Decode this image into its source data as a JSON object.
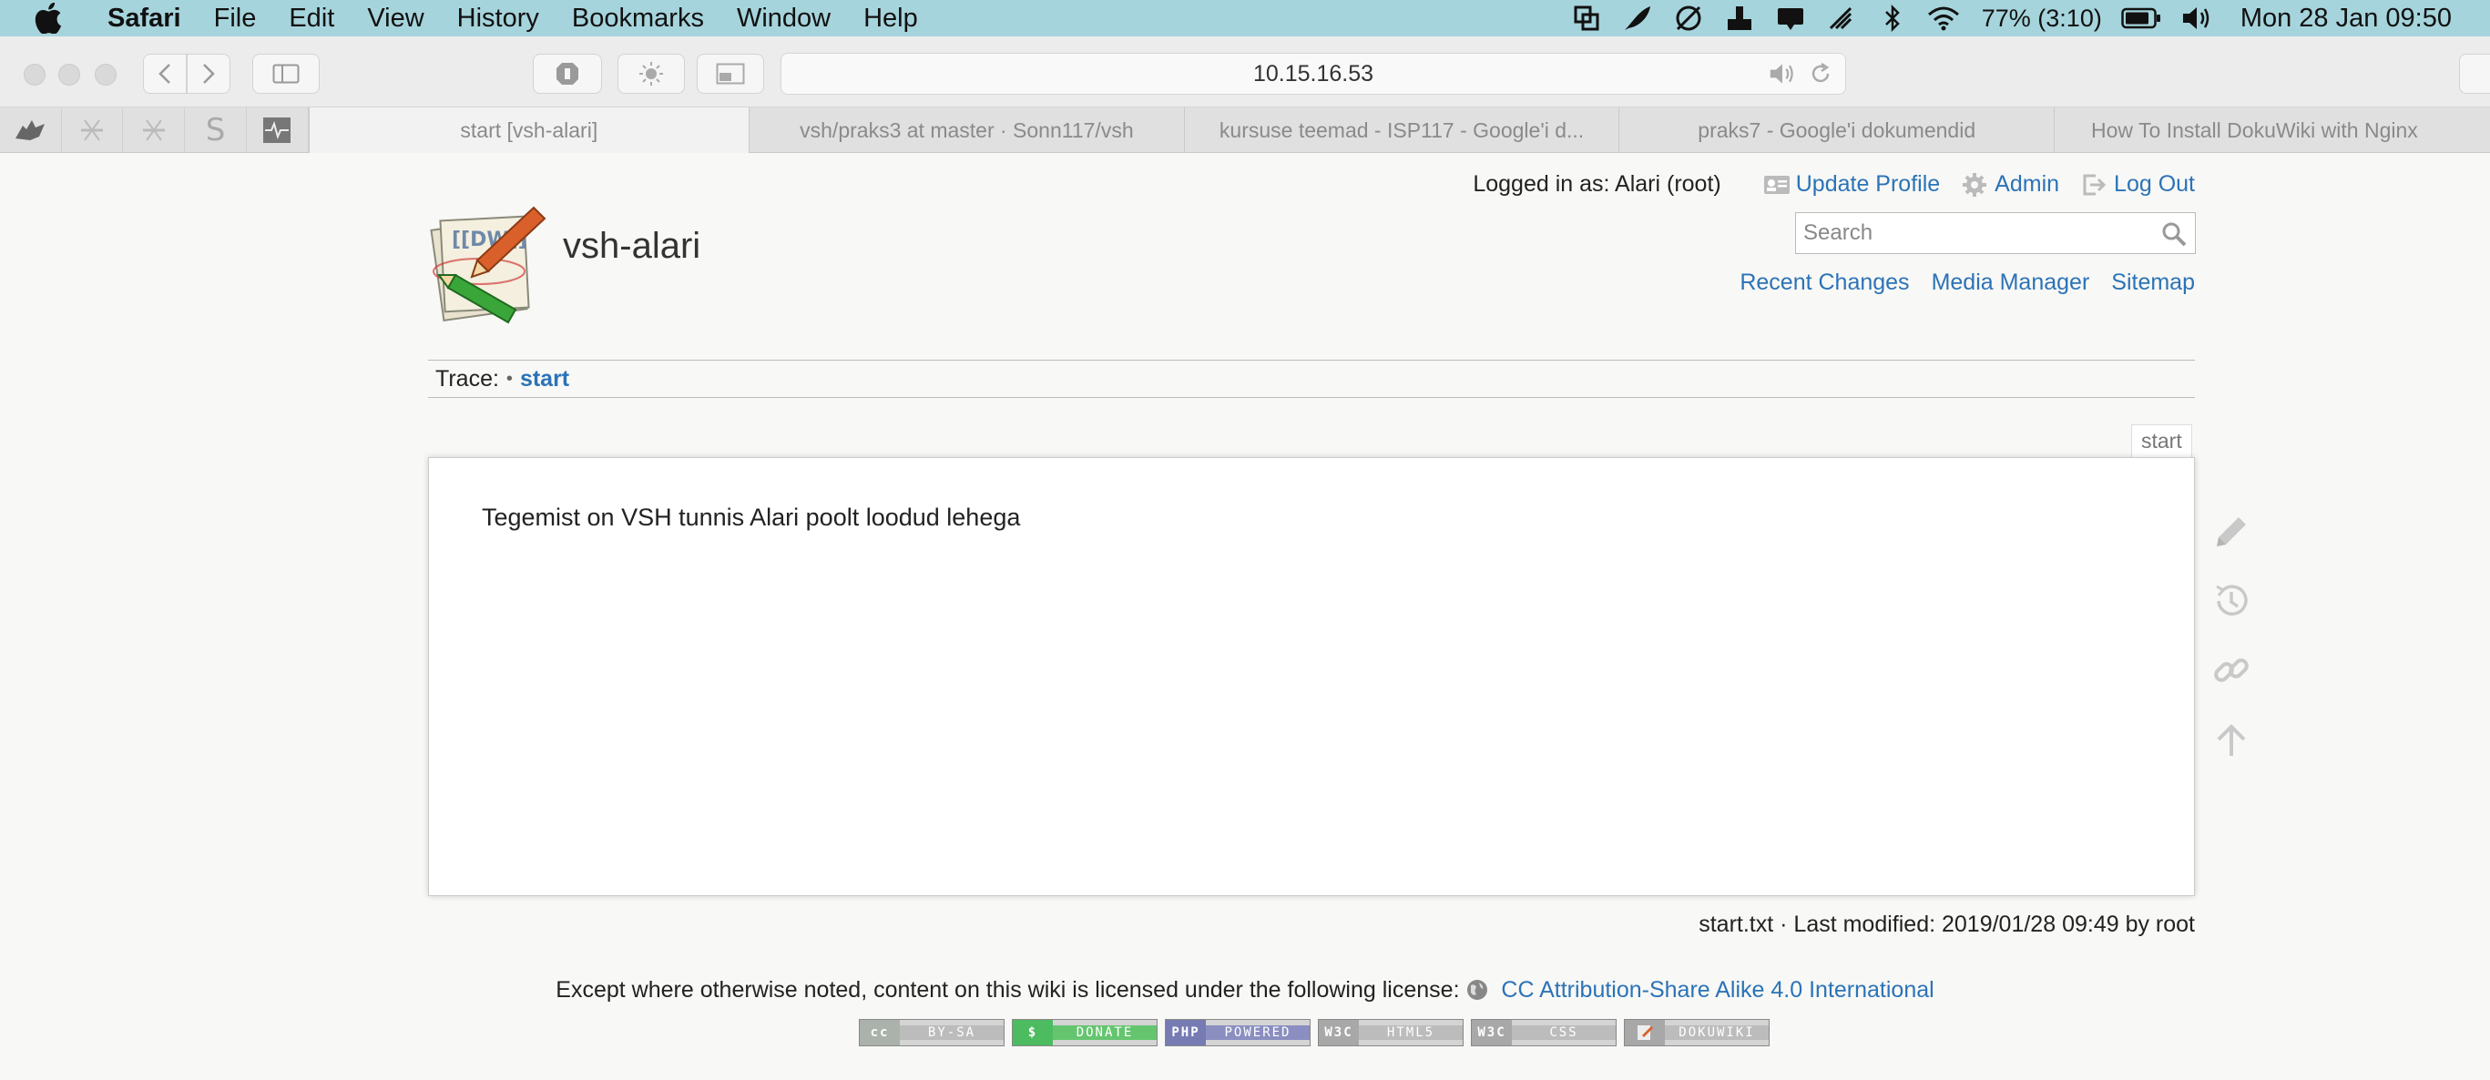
{
  "menubar": {
    "app": "Safari",
    "items": [
      "File",
      "Edit",
      "View",
      "History",
      "Bookmarks",
      "Window",
      "Help"
    ],
    "battery": "77% (3:10)",
    "clock": "Mon 28 Jan  09:50"
  },
  "browser": {
    "url": "10.15.16.53",
    "tabs": [
      {
        "title": "start [vsh-alari]",
        "active": true
      },
      {
        "title": "vsh/praks3 at master · Sonn117/vsh",
        "active": false
      },
      {
        "title": "kursuse teemad - ISP117 - Google'i d...",
        "active": false
      },
      {
        "title": "praks7 - Google'i dokumendid",
        "active": false
      },
      {
        "title": "How To Install DokuWiki with Nginx",
        "active": false
      }
    ],
    "favorites": [
      "wolf-icon",
      "tool-icon",
      "tool-icon",
      "s-icon",
      "pulse-icon"
    ],
    "favorite_s": "S"
  },
  "wiki": {
    "title": "vsh-alari",
    "logo_text": "[[DW]]",
    "user_tools": {
      "logged_in": "Logged in as: Alari (root)",
      "update_profile": "Update Profile",
      "admin": "Admin",
      "logout": "Log Out"
    },
    "search_placeholder": "Search",
    "site_tools": {
      "recent_changes": "Recent Changes",
      "media_manager": "Media Manager",
      "sitemap": "Sitemap"
    },
    "trace": {
      "label": "Trace:",
      "separator": "•",
      "crumb": "start"
    },
    "page_id": "start",
    "content": "Tegemist on VSH tunnis Alari poolt loodud lehega",
    "doc_info": "start.txt · Last modified: 2019/01/28 09:49 by root",
    "license": {
      "text": "Except where otherwise noted, content on this wiki is licensed under the following license:",
      "link": "CC Attribution-Share Alike 4.0 International"
    },
    "badges": [
      {
        "left": "cc",
        "right": "BY-SA",
        "color": "#aab2ab"
      },
      {
        "left": "$",
        "right": "DONATE",
        "color": "#4dbb5f"
      },
      {
        "left": "PHP",
        "right": "POWERED",
        "color": "#777bb3"
      },
      {
        "left": "W3C",
        "right": "HTML5",
        "color": "#a8a8a8"
      },
      {
        "left": "W3C",
        "right": "CSS",
        "color": "#a8a8a8"
      },
      {
        "left": "",
        "right": "DOKUWIKI",
        "color": "#a8a8a8"
      }
    ]
  },
  "colors": {
    "link": "#2b73b7",
    "menubar": "#a6d4dc",
    "page_bg": "#f8f8f6"
  }
}
